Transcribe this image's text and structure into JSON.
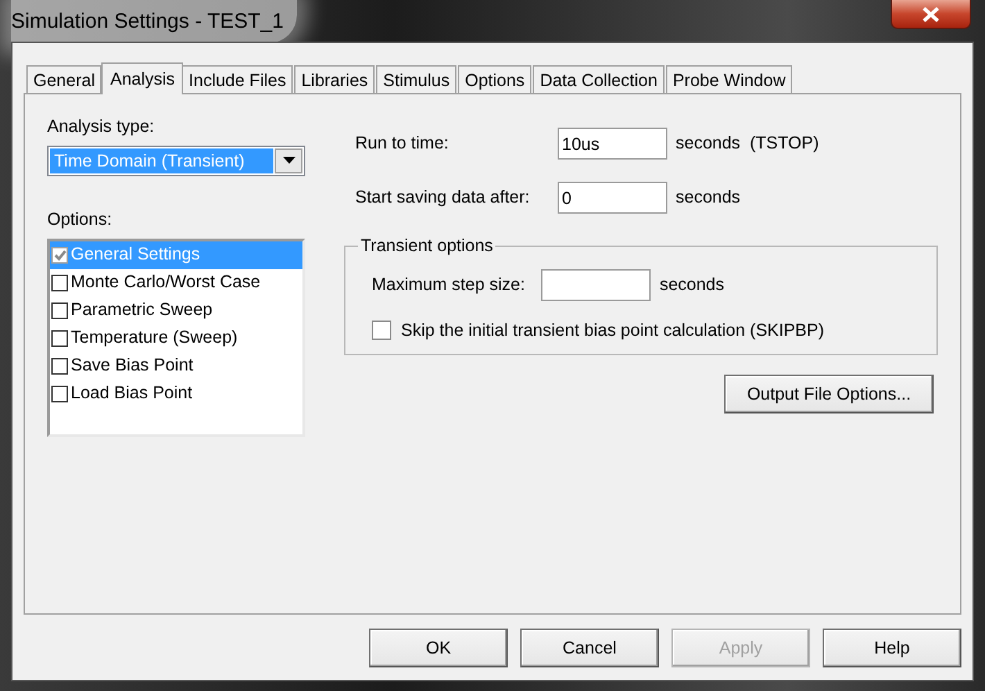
{
  "window": {
    "title": "Simulation Settings - TEST_1"
  },
  "tabs": [
    {
      "label": "General",
      "selected": false
    },
    {
      "label": "Analysis",
      "selected": true
    },
    {
      "label": "Include Files",
      "selected": false
    },
    {
      "label": "Libraries",
      "selected": false
    },
    {
      "label": "Stimulus",
      "selected": false
    },
    {
      "label": "Options",
      "selected": false
    },
    {
      "label": "Data Collection",
      "selected": false
    },
    {
      "label": "Probe Window",
      "selected": false
    }
  ],
  "analysis_type": {
    "label": "Analysis type:",
    "value": "Time Domain (Transient)"
  },
  "options": {
    "label": "Options:",
    "items": [
      {
        "label": "General Settings",
        "checked": true,
        "disabled": true,
        "selected": true
      },
      {
        "label": "Monte Carlo/Worst Case",
        "checked": false,
        "disabled": false,
        "selected": false
      },
      {
        "label": "Parametric Sweep",
        "checked": false,
        "disabled": false,
        "selected": false
      },
      {
        "label": "Temperature (Sweep)",
        "checked": false,
        "disabled": false,
        "selected": false
      },
      {
        "label": "Save Bias Point",
        "checked": false,
        "disabled": false,
        "selected": false
      },
      {
        "label": "Load Bias Point",
        "checked": false,
        "disabled": false,
        "selected": false
      }
    ]
  },
  "fields": [
    {
      "label": "Run to time:",
      "value": "10us",
      "unit": "seconds  (TSTOP)"
    },
    {
      "label": "Start saving data after:",
      "value": "0",
      "unit": "seconds"
    }
  ],
  "transient_options": {
    "legend": "Transient options",
    "max_step": {
      "label": "Maximum step size:",
      "unit": "seconds"
    },
    "skip_bias": {
      "label": "Skip the initial transient bias point calculation  (SKIPBP)",
      "checked": false
    }
  },
  "output_file_button": "Output File Options...",
  "buttons": [
    {
      "label": "OK",
      "disabled": false
    },
    {
      "label": "Cancel",
      "disabled": false
    },
    {
      "label": "Apply",
      "disabled": true
    },
    {
      "label": "Help",
      "disabled": false
    }
  ]
}
